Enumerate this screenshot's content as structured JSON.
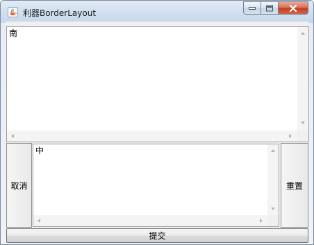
{
  "window": {
    "title": "利器BorderLayout"
  },
  "north_area": {
    "text": "南"
  },
  "center_area": {
    "text": "中"
  },
  "west_button": {
    "label": "取消"
  },
  "east_button": {
    "label": "重置"
  },
  "south_button": {
    "label": "提交"
  },
  "icons": {
    "app": "java-coffee-cup-icon",
    "minimize": "minimize-icon",
    "maximize": "maximize-icon",
    "close": "close-icon"
  },
  "colors": {
    "close_button": "#c43c22",
    "titlebar": "#d3e1f1",
    "panel_background": "#f0f0f0"
  }
}
